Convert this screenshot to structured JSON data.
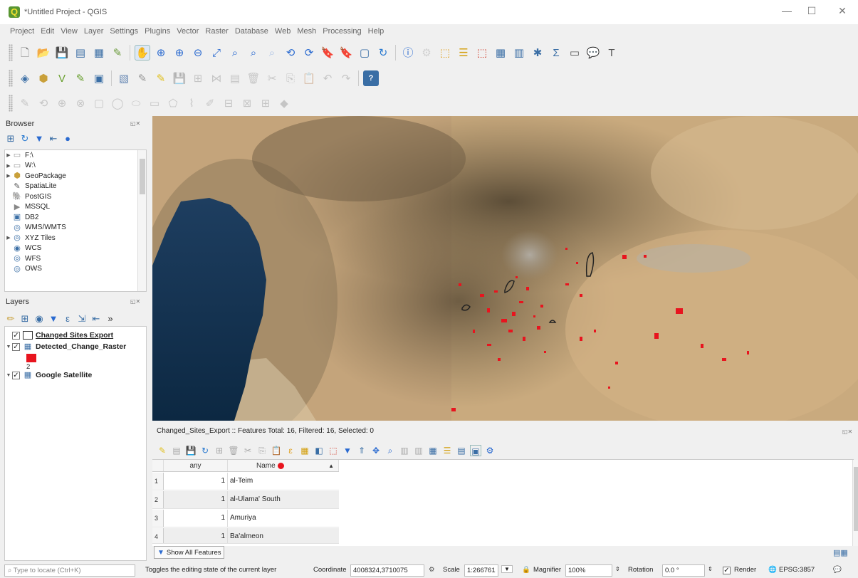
{
  "window": {
    "title": "*Untitled Project - QGIS",
    "minimize": "—",
    "maximize": "☐",
    "close": "✕"
  },
  "menu": [
    "Project",
    "Edit",
    "View",
    "Layer",
    "Settings",
    "Plugins",
    "Vector",
    "Raster",
    "Database",
    "Web",
    "Mesh",
    "Processing",
    "Help"
  ],
  "browser": {
    "title": "Browser",
    "items": [
      {
        "label": "F:\\",
        "expandable": true,
        "icon": "folder-icon"
      },
      {
        "label": "W:\\",
        "expandable": true,
        "icon": "folder-icon"
      },
      {
        "label": "GeoPackage",
        "expandable": true,
        "icon": "geopackage-icon"
      },
      {
        "label": "SpatiaLite",
        "expandable": false,
        "icon": "spatialite-icon"
      },
      {
        "label": "PostGIS",
        "expandable": false,
        "icon": "postgis-icon"
      },
      {
        "label": "MSSQL",
        "expandable": false,
        "icon": "mssql-icon"
      },
      {
        "label": "DB2",
        "expandable": false,
        "icon": "db2-icon"
      },
      {
        "label": "WMS/WMTS",
        "expandable": false,
        "icon": "wms-icon"
      },
      {
        "label": "XYZ Tiles",
        "expandable": true,
        "icon": "xyz-tiles-icon"
      },
      {
        "label": "WCS",
        "expandable": false,
        "icon": "wcs-icon"
      },
      {
        "label": "WFS",
        "expandable": false,
        "icon": "wfs-icon"
      },
      {
        "label": "OWS",
        "expandable": false,
        "icon": "ows-icon"
      }
    ]
  },
  "layers": {
    "title": "Layers",
    "items": [
      {
        "label": "Changed Sites Export",
        "checked": true,
        "underline": true
      },
      {
        "label": "Detected_Change_Raster",
        "checked": true,
        "legend_value": "2",
        "legend_color": "#e8141e"
      },
      {
        "label": "Google Satellite",
        "checked": true
      }
    ]
  },
  "attribute_table": {
    "title": "Changed_Sites_Export :: Features Total: 16, Filtered: 16, Selected: 0",
    "columns": [
      "any",
      "Name"
    ],
    "rows": [
      {
        "num": "1",
        "any": "1",
        "name": "al-Teim"
      },
      {
        "num": "2",
        "any": "1",
        "name": "al-Ulama' South"
      },
      {
        "num": "3",
        "any": "1",
        "name": "Amuriya"
      },
      {
        "num": "4",
        "any": "1",
        "name": "Ba'almeon"
      }
    ],
    "show_all": "Show All Features"
  },
  "status": {
    "locator_placeholder": "Type to locate (Ctrl+K)",
    "message": "Toggles the editing state of the current layer",
    "coordinate_label": "Coordinate",
    "coordinate": "4008324,3710075",
    "scale_label": "Scale",
    "scale": "1:266761",
    "magnifier_label": "Magnifier",
    "magnifier": "100%",
    "rotation_label": "Rotation",
    "rotation": "0.0 °",
    "render_label": "Render",
    "crs": "EPSG:3857"
  },
  "colors": {
    "change_red": "#e8141e",
    "water": "#0f2f50",
    "desert": "#c8a87c"
  }
}
